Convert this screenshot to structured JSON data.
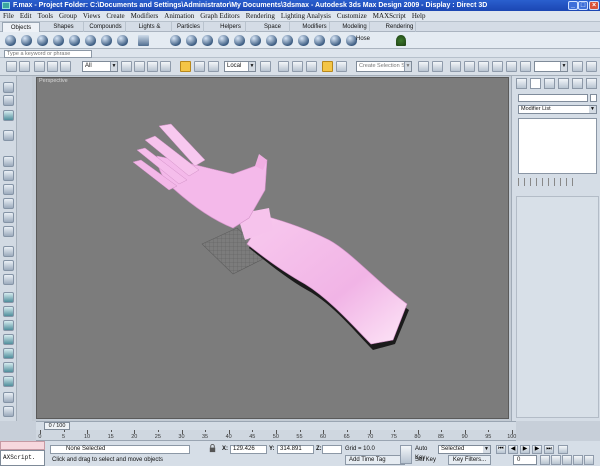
{
  "window": {
    "title": "F.max    - Project Folder: C:\\Documents and Settings\\Administrator\\My Documents\\3dsmax    - Autodesk 3ds Max Design 2009    - Display : Direct 3D",
    "minimize": "_",
    "maximize": "□",
    "close": "×"
  },
  "menu": [
    "File",
    "Edit",
    "Tools",
    "Group",
    "Views",
    "Create",
    "Modifiers",
    "Animation",
    "Graph Editors",
    "Rendering",
    "Lighting Analysis",
    "Customize",
    "MAXScript",
    "Help"
  ],
  "shelf_tabs": [
    {
      "label": "Objects",
      "active": true
    },
    {
      "label": "Shapes"
    },
    {
      "label": "Compounds"
    },
    {
      "label": "Lights & Cameras"
    },
    {
      "label": "Particles"
    },
    {
      "label": "Helpers"
    },
    {
      "label": "Space Warps"
    },
    {
      "label": "Modifiers"
    },
    {
      "label": "Modeling"
    },
    {
      "label": "Rendering"
    }
  ],
  "shelf_hose_label": "Hose",
  "search": {
    "placeholder": "Type a keyword or phrase"
  },
  "toolbar": {
    "filter_value": "All",
    "coord_system": "Local",
    "selection_set": "Create Selection Set"
  },
  "viewport": {
    "label": "Perspective"
  },
  "command_panel": {
    "modifier_list": "Modifier List"
  },
  "timeline": {
    "position": "0 / 100",
    "ticks": [
      "0",
      "5",
      "10",
      "15",
      "20",
      "25",
      "30",
      "35",
      "40",
      "45",
      "50",
      "55",
      "60",
      "65",
      "70",
      "75",
      "80",
      "85",
      "90",
      "95",
      "100"
    ]
  },
  "status": {
    "maxscript": "AXScript.",
    "selection": "None Selected",
    "prompt": "Click and drag to select and move objects",
    "x_label": "X:",
    "x_value": "129.426",
    "y_label": "Y:",
    "y_value": "314.891",
    "z_label": "Z:",
    "z_value": "",
    "grid": "Grid = 10.0",
    "add_time_tag": "Add Time Tag",
    "auto_key": "Auto Key",
    "set_key": "Set Key",
    "selected": "Selected",
    "key_filters": "Key Filters...",
    "frame": "0"
  },
  "colors": {
    "viewport_bg": "#7c7c7c",
    "model_pink": "#f2b8e8",
    "titlebar": "#1b46b3"
  }
}
